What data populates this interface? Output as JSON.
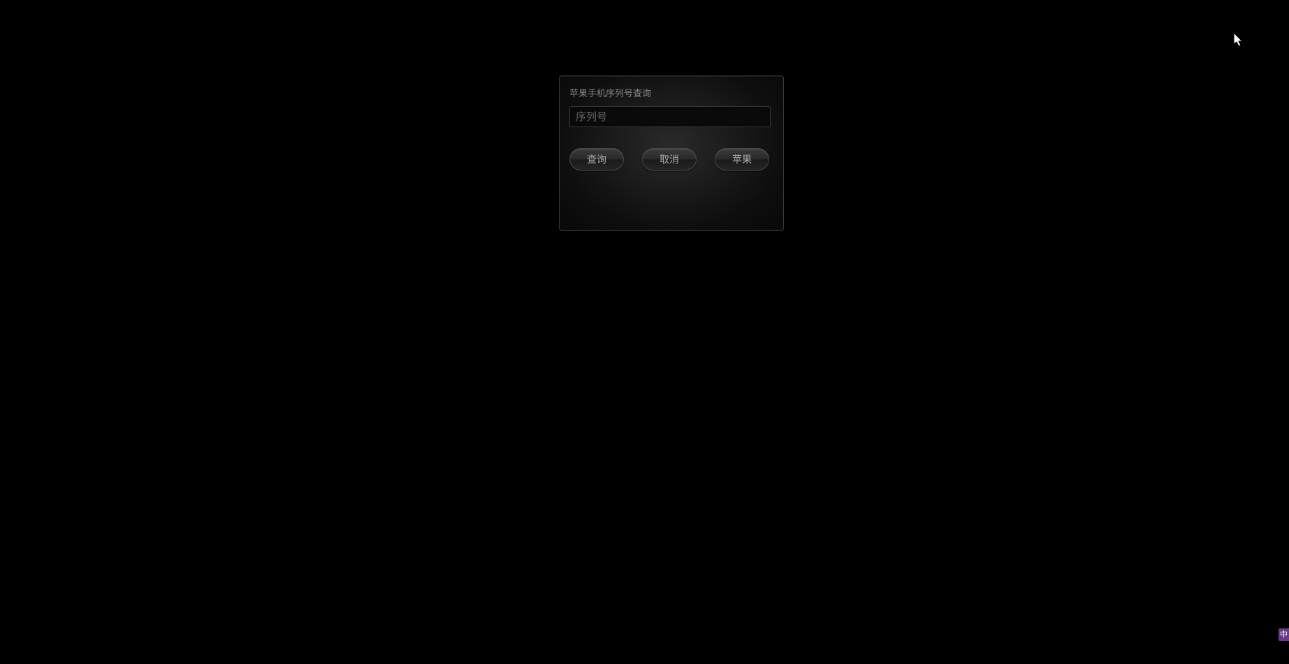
{
  "dialog": {
    "title": "苹果手机序列号查询",
    "input": {
      "placeholder": "序列号",
      "value": ""
    },
    "buttons": {
      "search": "查询",
      "cancel": "取消",
      "apple": "苹果"
    }
  },
  "ime": {
    "label": "中"
  }
}
